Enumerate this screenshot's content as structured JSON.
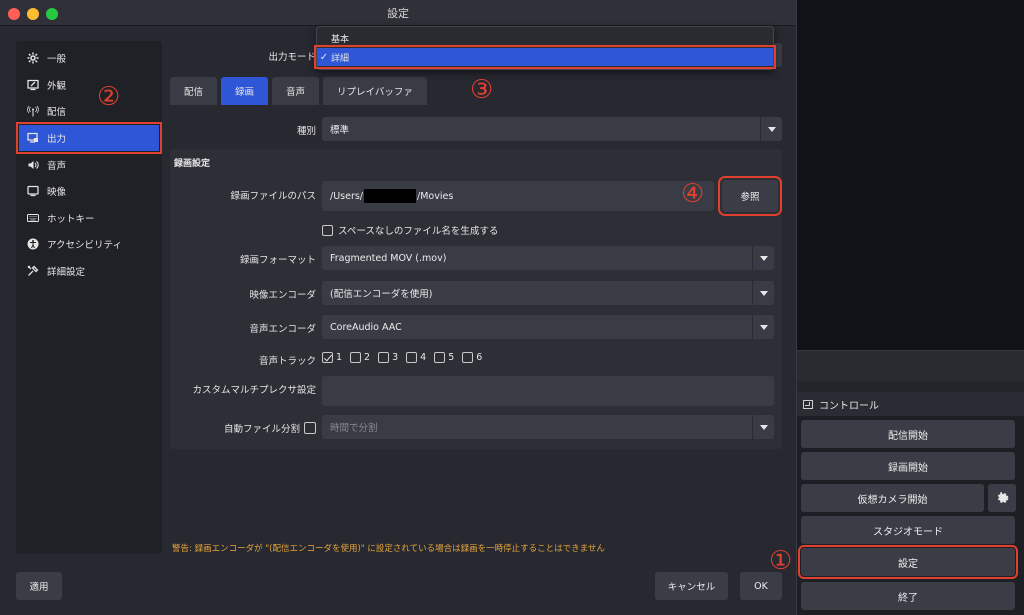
{
  "window": {
    "title": "設定"
  },
  "sidebar": {
    "items": [
      {
        "label": "一般",
        "icon": "gear-icon"
      },
      {
        "label": "外観",
        "icon": "appearance-icon"
      },
      {
        "label": "配信",
        "icon": "antenna-icon"
      },
      {
        "label": "出力",
        "icon": "output-monitor-icon"
      },
      {
        "label": "音声",
        "icon": "speaker-icon"
      },
      {
        "label": "映像",
        "icon": "monitor-icon"
      },
      {
        "label": "ホットキー",
        "icon": "keyboard-icon"
      },
      {
        "label": "アクセシビリティ",
        "icon": "accessibility-icon"
      },
      {
        "label": "詳細設定",
        "icon": "tools-icon"
      }
    ],
    "active_index": 3
  },
  "output_mode": {
    "label": "出力モード",
    "options": [
      "基本",
      "詳細"
    ],
    "selected": "詳細",
    "check_mark": "✓"
  },
  "tabs": [
    "配信",
    "録画",
    "音声",
    "リプレイバッファ"
  ],
  "active_tab": "録画",
  "type": {
    "label": "種別",
    "value": "標準"
  },
  "recording": {
    "section_title": "録画設定",
    "path_label": "録画ファイルのパス",
    "path_prefix": "/Users/",
    "path_suffix": "/Movies",
    "browse_label": "参照",
    "no_space_label": "スペースなしのファイル名を生成する",
    "format_label": "録画フォーマット",
    "format_value": "Fragmented MOV (.mov)",
    "video_encoder_label": "映像エンコーダ",
    "video_encoder_value": "(配信エンコーダを使用)",
    "audio_encoder_label": "音声エンコーダ",
    "audio_encoder_value": "CoreAudio AAC",
    "audio_track_label": "音声トラック",
    "tracks": [
      {
        "label": "1",
        "checked": true
      },
      {
        "label": "2",
        "checked": false
      },
      {
        "label": "3",
        "checked": false
      },
      {
        "label": "4",
        "checked": false
      },
      {
        "label": "5",
        "checked": false
      },
      {
        "label": "6",
        "checked": false
      }
    ],
    "muxer_label": "カスタムマルチプレクサ設定",
    "muxer_value": "",
    "split_label": "自動ファイル分割",
    "split_value": "時間で分割"
  },
  "warning": "警告: 録画エンコーダが \"(配信エンコーダを使用)\" に設定されている場合は録画を一時停止することはできません",
  "footer": {
    "apply": "適用",
    "cancel": "キャンセル",
    "ok": "OK"
  },
  "controls": {
    "title": "コントロール",
    "buttons": [
      "配信開始",
      "録画開始",
      "仮想カメラ開始",
      "スタジオモード",
      "設定",
      "終了"
    ]
  },
  "annotations": [
    "①",
    "②",
    "③",
    "④"
  ],
  "colors": {
    "accent": "#2e56d6",
    "highlight": "#e0402e",
    "warning": "#e6a53a"
  }
}
